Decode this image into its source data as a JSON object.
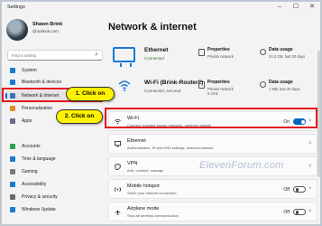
{
  "window": {
    "title": "Settings"
  },
  "user": {
    "name": "Shawn Brink",
    "email": "@outlook.com"
  },
  "search": {
    "placeholder": "Find a setting"
  },
  "nav": [
    {
      "label": "System",
      "icon": "system-icon",
      "color": "#1a7ad4"
    },
    {
      "label": "Bluetooth & devices",
      "icon": "bluetooth-icon",
      "color": "#1a7ad4"
    },
    {
      "label": "Network & internet",
      "icon": "network-icon",
      "color": "#3b6fb6"
    },
    {
      "label": "Personalization",
      "icon": "personalization-icon",
      "color": "#e08a2e"
    },
    {
      "label": "Apps",
      "icon": "apps-icon",
      "color": "#6a6a8a"
    },
    {
      "label": "Accounts",
      "icon": "accounts-icon",
      "color": "#2da24d"
    },
    {
      "label": "Time & language",
      "icon": "clock-icon",
      "color": "#1a7ad4"
    },
    {
      "label": "Gaming",
      "icon": "gaming-icon",
      "color": "#7a7a7a"
    },
    {
      "label": "Accessibility",
      "icon": "accessibility-icon",
      "color": "#1a7ad4"
    },
    {
      "label": "Privacy & security",
      "icon": "shield-icon",
      "color": "#6a6a6a"
    },
    {
      "label": "Windows Update",
      "icon": "update-icon",
      "color": "#1a7ad4"
    }
  ],
  "page": {
    "title": "Network & internet"
  },
  "hero": {
    "ethernet": {
      "name": "Ethernet",
      "status": "Connected",
      "props": "Properties",
      "props_sub": "Private network",
      "usage": "Data usage",
      "usage_sub": "24.2 GB, last 30 days"
    },
    "wifi": {
      "name": "Wi-Fi (Brink-Router2)",
      "status": "Connected, secured",
      "props": "Properties",
      "props_sub": "Private network",
      "props_sub2": "5 GHz",
      "usage": "Data usage",
      "usage_sub": "1 MB, last 30 days"
    }
  },
  "cards": {
    "wifi": {
      "title": "Wi-Fi",
      "sub": "Connect, manage known networks, metered network",
      "state": "On"
    },
    "ethernet": {
      "title": "Ethernet",
      "sub": "Authentication, IP and DNS settings, metered network"
    },
    "vpn": {
      "title": "VPN",
      "sub": "Add, connect, manage"
    },
    "hotspot": {
      "title": "Mobile hotspot",
      "sub": "Share your internet connection",
      "state": "Off"
    },
    "airplane": {
      "title": "Airplane mode",
      "sub": "Stop all wireless communication",
      "state": "Off"
    }
  },
  "callouts": {
    "one": "1. Click on",
    "two": "2. Click on"
  },
  "watermark": "ElevenForum.com"
}
